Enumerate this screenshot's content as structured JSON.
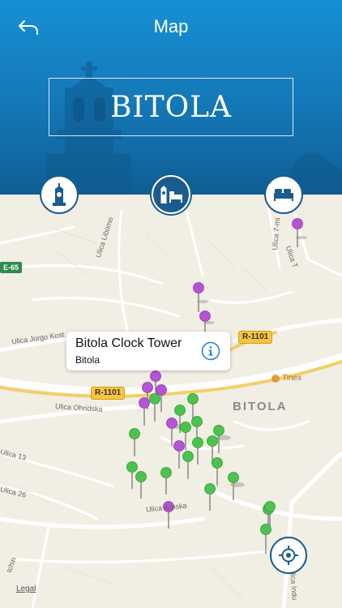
{
  "header": {
    "title": "Map",
    "city": "BITOLA",
    "back_icon": "back-arrow-icon"
  },
  "categories": [
    {
      "name": "landmarks",
      "icon": "clock-tower-icon",
      "active": false
    },
    {
      "name": "all",
      "icon": "tower-and-bed-icon",
      "active": true
    },
    {
      "name": "hotels",
      "icon": "bed-icon",
      "active": false
    }
  ],
  "callout": {
    "title": "Bitola Clock Tower",
    "subtitle": "Bitola",
    "info_icon": "info-icon"
  },
  "map": {
    "city_label": "BITOLA",
    "roads": {
      "r1101_a": "R-1101",
      "r1101_b": "R-1101",
      "e65": "E-65"
    },
    "streets": {
      "jorgo": "Ulica Jorgo Kost",
      "ohridska": "Ulica Ohridska",
      "libomo": "Ulica Libomo",
      "sedmi": "Ulica 7-mi",
      "ilunska": "Ulica  ilunska",
      "ulica_t": "Ulica T",
      "ulica_13": "Ulica 13",
      "ulica_26": "Ulica 26",
      "tchin": "tchin",
      "indu": "Ulica Indu"
    },
    "poi": "Tinex",
    "legal": "Legal",
    "locate_icon": "locate-crosshair-icon"
  },
  "colors": {
    "header_blue": "#1577b6",
    "button_border": "#1a5c8e",
    "pin_green": "#4ec24e",
    "pin_purple": "#b653d6"
  }
}
